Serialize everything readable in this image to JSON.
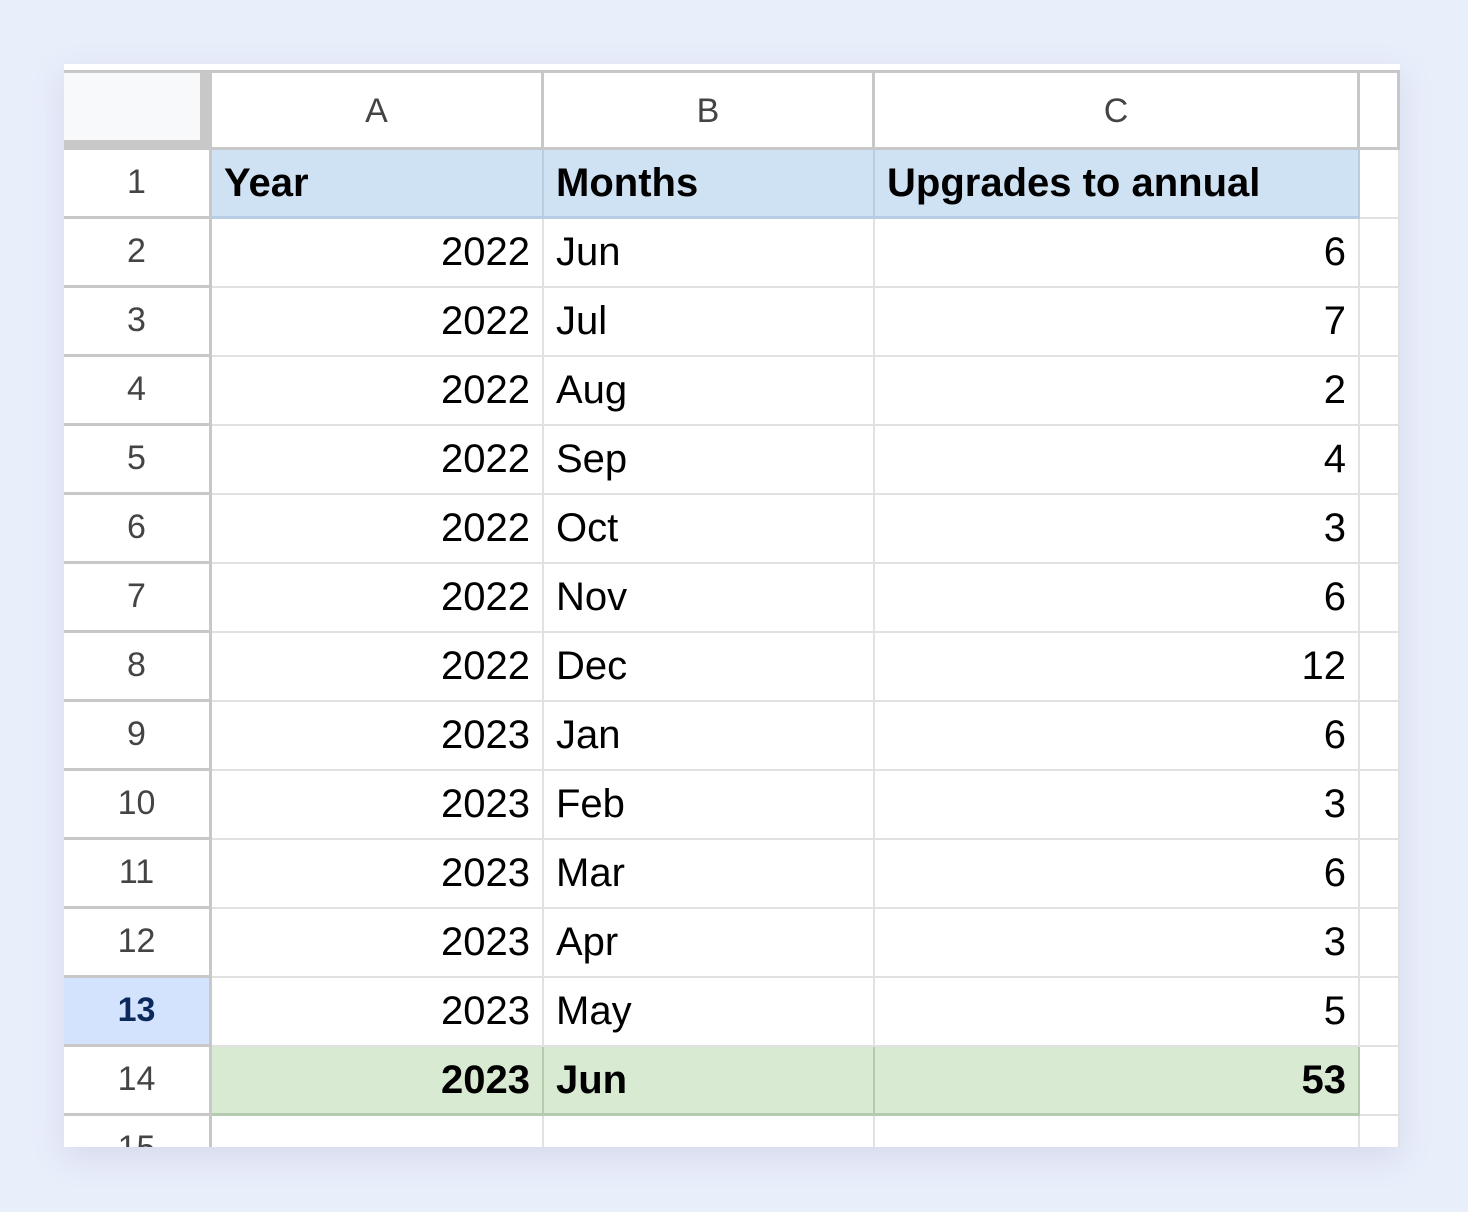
{
  "columns": [
    "A",
    "B",
    "C"
  ],
  "header_row": {
    "row_number": "1",
    "cells": [
      "Year",
      "Months",
      "Upgrades to annual"
    ]
  },
  "rows": [
    {
      "row_number": "2",
      "year": "2022",
      "month": "Jun",
      "upgrades": "6"
    },
    {
      "row_number": "3",
      "year": "2022",
      "month": "Jul",
      "upgrades": "7"
    },
    {
      "row_number": "4",
      "year": "2022",
      "month": "Aug",
      "upgrades": "2"
    },
    {
      "row_number": "5",
      "year": "2022",
      "month": "Sep",
      "upgrades": "4"
    },
    {
      "row_number": "6",
      "year": "2022",
      "month": "Oct",
      "upgrades": "3"
    },
    {
      "row_number": "7",
      "year": "2022",
      "month": "Nov",
      "upgrades": "6"
    },
    {
      "row_number": "8",
      "year": "2022",
      "month": "Dec",
      "upgrades": "12"
    },
    {
      "row_number": "9",
      "year": "2023",
      "month": "Jan",
      "upgrades": "6"
    },
    {
      "row_number": "10",
      "year": "2023",
      "month": "Feb",
      "upgrades": "3"
    },
    {
      "row_number": "11",
      "year": "2023",
      "month": "Mar",
      "upgrades": "6"
    },
    {
      "row_number": "12",
      "year": "2023",
      "month": "Apr",
      "upgrades": "3"
    },
    {
      "row_number": "13",
      "year": "2023",
      "month": "May",
      "upgrades": "5",
      "selected": true
    },
    {
      "row_number": "14",
      "year": "2023",
      "month": "Jun",
      "upgrades": "53",
      "total": true
    }
  ],
  "trailing_row_number": "15",
  "colors": {
    "header_fill": "#cfe2f3",
    "total_fill": "#d9ead3",
    "selected_row_header": "#d3e3fd"
  }
}
